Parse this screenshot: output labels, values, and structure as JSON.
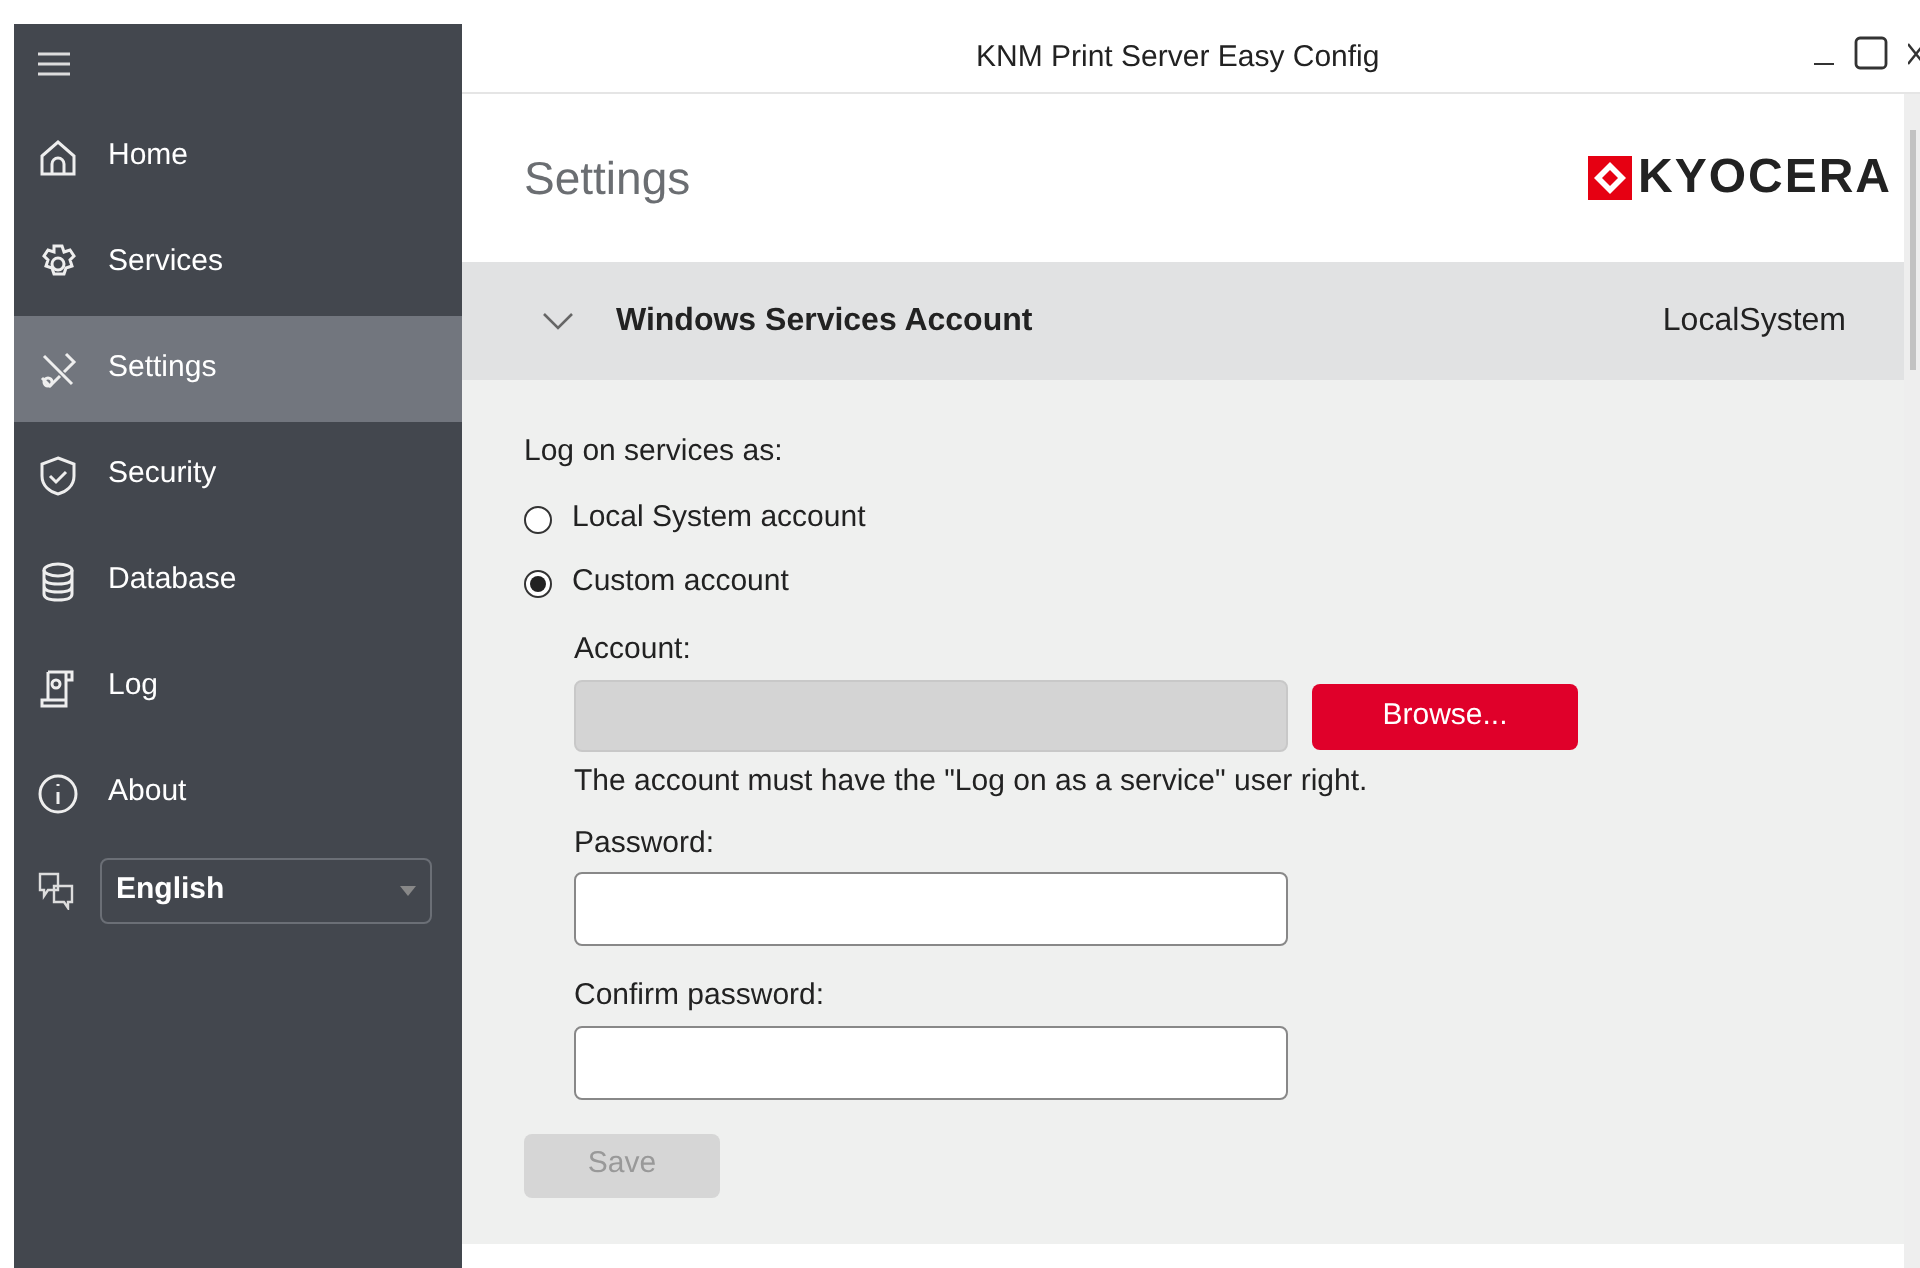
{
  "window": {
    "title": "KNM Print Server Easy Config"
  },
  "sidebar": {
    "items": [
      {
        "label": "Home",
        "selected": false
      },
      {
        "label": "Services",
        "selected": false
      },
      {
        "label": "Settings",
        "selected": true
      },
      {
        "label": "Security",
        "selected": false
      },
      {
        "label": "Database",
        "selected": false
      },
      {
        "label": "Log",
        "selected": false
      },
      {
        "label": "About",
        "selected": false
      }
    ],
    "language": {
      "value": "English"
    }
  },
  "page": {
    "title": "Settings",
    "logo": "KYOCERA"
  },
  "section": {
    "title": "Windows Services Account",
    "value": "LocalSystem",
    "expanded": true,
    "prompt": "Log on services as:",
    "options": [
      {
        "label": "Local System account",
        "selected": false
      },
      {
        "label": "Custom account",
        "selected": true
      }
    ],
    "account": {
      "label": "Account:",
      "disabled": true
    },
    "browse": "Browse...",
    "note": "The account must have the \"Log on as a service\" user right.",
    "password": {
      "label": "Password:"
    },
    "confirm": {
      "label": "Confirm password:"
    },
    "save": {
      "label": "Save",
      "disabled": true
    }
  }
}
